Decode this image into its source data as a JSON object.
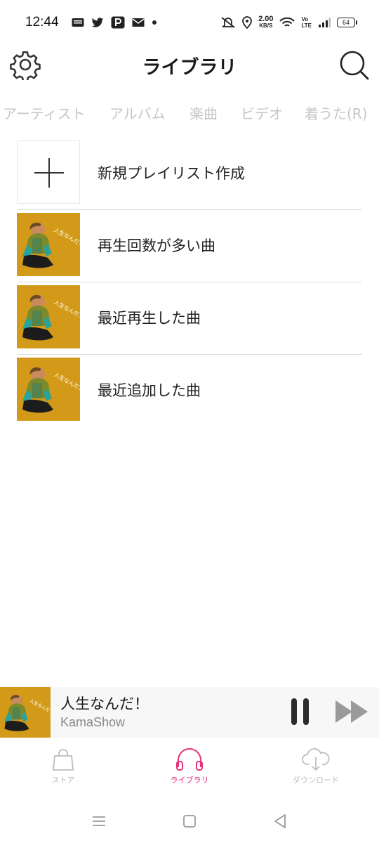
{
  "status_bar": {
    "time": "12:44",
    "net_speed_value": "2.00",
    "net_speed_unit": "KB/S",
    "volte_top": "Vo",
    "volte_bottom": "LTE",
    "battery": "64"
  },
  "header": {
    "title": "ライブラリ",
    "settings_icon": "gear-icon",
    "search_icon": "search-icon"
  },
  "tabs": [
    "アーティスト",
    "アルバム",
    "楽曲",
    "ビデオ",
    "着うた(R)"
  ],
  "playlists": [
    {
      "label": "新規プレイリスト作成",
      "icon": "plus-icon"
    },
    {
      "label": "再生回数が多い曲",
      "art_text": "人生なんだ！"
    },
    {
      "label": "最近再生した曲",
      "art_text": "人生なんだ！"
    },
    {
      "label": "最近追加した曲",
      "art_text": "人生なんだ！"
    }
  ],
  "mini_player": {
    "title": "人生なんだ！",
    "artist": "KamaShow",
    "art_text": "人生なんだ！"
  },
  "bottom_nav": [
    {
      "label": "ストア",
      "icon": "shopping-bag-icon",
      "active": false
    },
    {
      "label": "ライブラリ",
      "icon": "headphones-icon",
      "active": true
    },
    {
      "label": "ダウンロード",
      "icon": "cloud-download-icon",
      "active": false
    }
  ],
  "colors": {
    "accent": "#e8307c",
    "album_art_bg": "#d29a18",
    "tab_inactive": "#c6c6c6"
  }
}
